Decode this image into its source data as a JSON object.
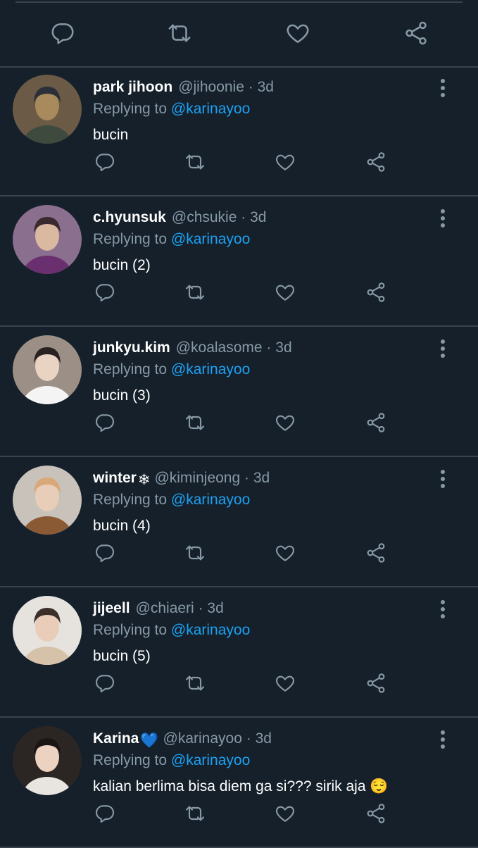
{
  "tweets": [
    {
      "name": "park jihoon",
      "badge": "",
      "handle": "@jihoonie",
      "dot": "·",
      "time": "3d",
      "reply_prefix": "Replying to ",
      "reply_to": "@karinayoo",
      "text": "bucin",
      "text_emoji": "",
      "avatar_colors": [
        "#6b5a45",
        "#a88a5c",
        "#3e4a3d",
        "#2a2f38"
      ]
    },
    {
      "name": "c.hyunsuk",
      "badge": "",
      "handle": "@chsukie",
      "dot": "·",
      "time": "3d",
      "reply_prefix": "Replying to ",
      "reply_to": "@karinayoo",
      "text": "bucin (2)",
      "text_emoji": "",
      "avatar_colors": [
        "#8a6f8e",
        "#d9b9a0",
        "#6a2f6e",
        "#3a2a30"
      ]
    },
    {
      "name": "junkyu.kim",
      "badge": "",
      "handle": "@koalasome",
      "dot": "·",
      "time": "3d",
      "reply_prefix": "Replying to ",
      "reply_to": "@karinayoo",
      "text": "bucin (3)",
      "text_emoji": "",
      "avatar_colors": [
        "#9b8f86",
        "#e9d3c3",
        "#f4f4f4",
        "#2a2222"
      ]
    },
    {
      "name": "winter",
      "badge": "❄",
      "handle": "@kiminjeong",
      "dot": "·",
      "time": "3d",
      "reply_prefix": "Replying to ",
      "reply_to": "@karinayoo",
      "text": "bucin (4)",
      "text_emoji": "",
      "avatar_colors": [
        "#c9c2ba",
        "#e8cdb8",
        "#8a5a35",
        "#d8a878"
      ]
    },
    {
      "name": "jijeell",
      "badge": "",
      "handle": "@chiaeri",
      "dot": "·",
      "time": "3d",
      "reply_prefix": "Replying to ",
      "reply_to": "@karinayoo",
      "text": "bucin (5)",
      "text_emoji": "",
      "avatar_colors": [
        "#e6e3df",
        "#e9cdb8",
        "#d6c2a8",
        "#3a2f2a"
      ]
    },
    {
      "name": "Karina",
      "badge": "💙",
      "handle": "@karinayoo",
      "dot": "·",
      "time": "3d",
      "reply_prefix": "Replying to ",
      "reply_to": "@karinayoo",
      "text": "kalian berlima bisa diem ga si??? sirik aja",
      "text_emoji": "😌",
      "avatar_colors": [
        "#2b2624",
        "#ecd2c0",
        "#e8e4e0",
        "#1a1414"
      ]
    }
  ],
  "colors": {
    "background": "#15202b",
    "divider": "#38444d",
    "secondary_text": "#8899a6",
    "link": "#1da1f2"
  },
  "icons": {
    "reply": "reply-icon",
    "retweet": "retweet-icon",
    "like": "like-icon",
    "share": "share-icon",
    "more": "more-icon"
  }
}
